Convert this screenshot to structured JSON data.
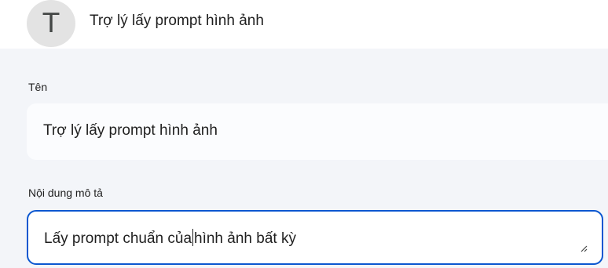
{
  "header": {
    "avatar_letter": "T",
    "title": "Trợ lý lấy prompt hình ảnh"
  },
  "form": {
    "name_label": "Tên",
    "name_value": "Trợ lý lấy prompt hình ảnh",
    "description_label": "Nội dung mô tả",
    "description_before_caret": "Lấy prompt chuẩn của",
    "description_after_caret": "hình ảnh bất kỳ"
  },
  "colors": {
    "focus_border": "#0b57d0",
    "panel_background": "#f3f5f9",
    "avatar_background": "#e3e3e3"
  },
  "icons": {
    "resize": "resize-handle-icon"
  }
}
